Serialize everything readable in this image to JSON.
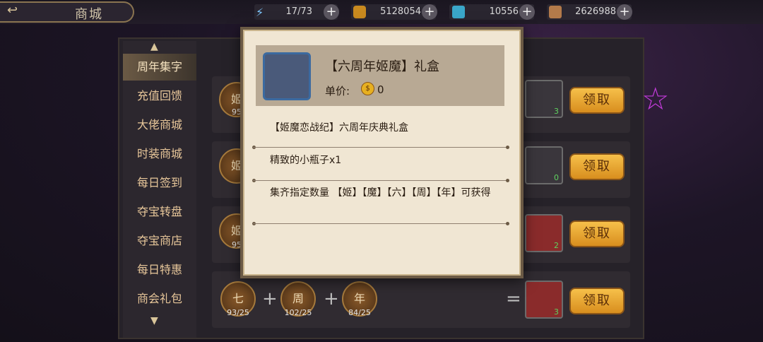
{
  "header": {
    "title": "商城"
  },
  "resources": [
    {
      "icon": "lightning-icon",
      "value": "17/73"
    },
    {
      "icon": "gold-coin-icon",
      "value": "5128054"
    },
    {
      "icon": "ticket-icon",
      "value": "10556"
    },
    {
      "icon": "gem-icon",
      "value": "2626988"
    }
  ],
  "sidebar": {
    "items": [
      {
        "label": "周年集字",
        "active": true
      },
      {
        "label": "充值回馈"
      },
      {
        "label": "大佬商城"
      },
      {
        "label": "时装商城"
      },
      {
        "label": "每日签到"
      },
      {
        "label": "夺宝转盘"
      },
      {
        "label": "夺宝商店"
      },
      {
        "label": "每日特惠"
      },
      {
        "label": "商会礼包"
      }
    ]
  },
  "rows": [
    {
      "coin_char": "姬",
      "coin_count": "95",
      "reward_count": "3",
      "claim": "领取"
    },
    {
      "coin_char": "姬",
      "coin_count": "",
      "reward_count": "0",
      "claim": "领取"
    },
    {
      "coin_char": "姬",
      "coin_count": "95",
      "reward_count": "2",
      "claim": "领取"
    },
    {
      "claim": "领取",
      "reward_count": "3",
      "coins": [
        {
          "char": "七",
          "count": "93/25"
        },
        {
          "char": "周",
          "count": "102/25"
        },
        {
          "char": "年",
          "count": "84/25"
        }
      ]
    }
  ],
  "modal": {
    "title": "【六周年姬魔】礼盒",
    "price_label": "单价:",
    "price_value": "0",
    "line1": "【姬魔恋战纪】六周年庆典礼盒",
    "line2": "精致的小瓶子x1",
    "line3": "集齐指定数量 【姬】【魔】【六】【周】【年】可获得"
  }
}
